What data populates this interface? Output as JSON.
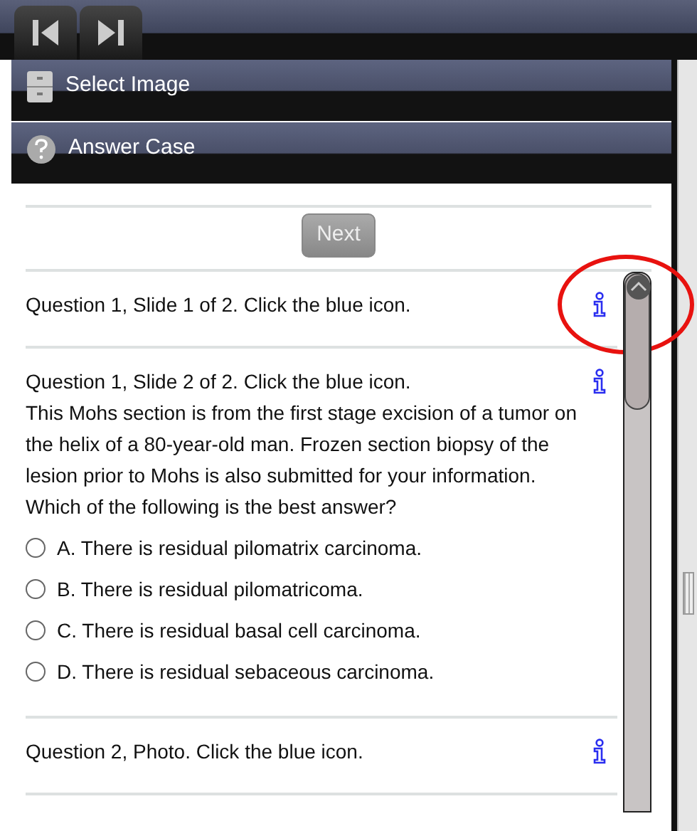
{
  "toolbar": {
    "buttons": [
      {
        "kind": "first"
      },
      {
        "kind": "last"
      }
    ]
  },
  "menu": [
    {
      "kind": "drawer",
      "label": "Select Image"
    },
    {
      "kind": "help",
      "label": "Answer Case"
    }
  ],
  "next_button": {
    "label": "Next"
  },
  "items": [
    {
      "kind": "note",
      "text": "Question 1, Slide 1 of 2. Click the blue icon.",
      "highlighted": true
    },
    {
      "kind": "question",
      "title": "Question 1, Slide 2 of 2. Click the blue icon.",
      "body": "This Mohs section is from the first stage excision of a tumor on the helix of a 80-year-old man. Frozen section biopsy of the lesion prior to Mohs is also submitted for your information.",
      "prompt": "Which of the following is the best answer?",
      "options": [
        {
          "label": "A. There is residual pilomatrix carcinoma.",
          "selected": false
        },
        {
          "label": "B. There is residual pilomatricoma.",
          "selected": false
        },
        {
          "label": "C. There is residual basal cell carcinoma.",
          "selected": false
        },
        {
          "label": "D. There is residual sebaceous carcinoma.",
          "selected": false
        }
      ]
    },
    {
      "kind": "note",
      "text": "Question 2, Photo. Click the blue icon.",
      "highlighted": false
    }
  ]
}
